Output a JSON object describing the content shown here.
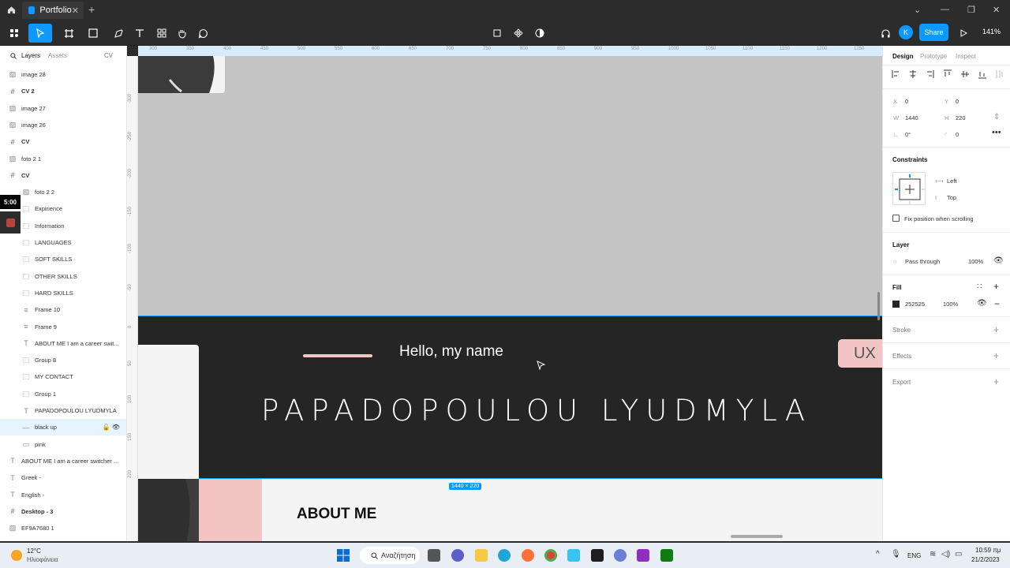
{
  "titlebar": {
    "tab_title": "Portfolio",
    "close": "✕",
    "new_tab": "+"
  },
  "toolbar": {
    "share_label": "Share",
    "zoom": "141%",
    "user_initial": "K"
  },
  "leftpanel": {
    "tabs": {
      "layers": "Layers",
      "assets": "Assets",
      "page": "CV"
    },
    "layers": [
      {
        "label": "image 28",
        "kind": "image",
        "indent": 0
      },
      {
        "label": "CV 2",
        "kind": "frame",
        "indent": 0
      },
      {
        "label": "image 27",
        "kind": "image",
        "indent": 0
      },
      {
        "label": "image 26",
        "kind": "image",
        "indent": 0
      },
      {
        "label": "CV",
        "kind": "frame",
        "indent": 0
      },
      {
        "label": "foto 2 1",
        "kind": "image",
        "indent": 0
      },
      {
        "label": "CV",
        "kind": "frame",
        "indent": 0
      },
      {
        "label": "foto 2 2",
        "kind": "image",
        "indent": 1
      },
      {
        "label": "Expirience",
        "kind": "group",
        "indent": 1
      },
      {
        "label": "Information",
        "kind": "group",
        "indent": 1
      },
      {
        "label": "LANGUAGES",
        "kind": "group",
        "indent": 1
      },
      {
        "label": "SOFT SKILLS",
        "kind": "group",
        "indent": 1
      },
      {
        "label": "OTHER SKILLS",
        "kind": "group",
        "indent": 1
      },
      {
        "label": "HARD SKILLS",
        "kind": "group",
        "indent": 1
      },
      {
        "label": "Frame 10",
        "kind": "autolayout",
        "indent": 1
      },
      {
        "label": "Frame 9",
        "kind": "autolayout",
        "indent": 1
      },
      {
        "label": "ABOUT ME I am a career swit...",
        "kind": "text",
        "indent": 1
      },
      {
        "label": "Group 8",
        "kind": "group",
        "indent": 1
      },
      {
        "label": "MY CONTACT",
        "kind": "group",
        "indent": 1
      },
      {
        "label": "Group 1",
        "kind": "group",
        "indent": 1
      },
      {
        "label": "PAPADOPOULOU LYUDMYLA",
        "kind": "text",
        "indent": 1
      },
      {
        "label": "black up",
        "kind": "rect",
        "indent": 1,
        "selected": true
      },
      {
        "label": "pink",
        "kind": "rect",
        "indent": 1
      },
      {
        "label": "ABOUT ME I am a career switcher ...",
        "kind": "text",
        "indent": 0
      },
      {
        "label": "Greek -",
        "kind": "text",
        "indent": 0
      },
      {
        "label": "English -",
        "kind": "text",
        "indent": 0
      },
      {
        "label": "Desktop - 3",
        "kind": "frame",
        "indent": 0
      },
      {
        "label": "EF9A7680 1",
        "kind": "image",
        "indent": 0
      }
    ],
    "timer": "5:00"
  },
  "ruler": {
    "top": [
      "300",
      "350",
      "400",
      "450",
      "500",
      "550",
      "600",
      "650",
      "700",
      "750",
      "800",
      "850",
      "900",
      "950",
      "1000",
      "1050",
      "1100",
      "1150",
      "1200",
      "1250"
    ],
    "left": [
      "-300",
      "-250",
      "-200",
      "-150",
      "-100",
      "-50",
      "0",
      "50",
      "100",
      "150",
      "220"
    ]
  },
  "canvas": {
    "hello": "Hello, my name",
    "name": "PAPADOPOULOU LYUDMYLA",
    "ux": "UX",
    "about": "ABOUT ME",
    "dimensions": "1440 × 220",
    "help": "?"
  },
  "rightpanel": {
    "tabs": {
      "design": "Design",
      "prototype": "Prototype",
      "inspect": "Inspect"
    },
    "x_label": "X",
    "x": "0",
    "y_label": "Y",
    "y": "0",
    "w_label": "W",
    "w": "1440",
    "h_label": "H",
    "h": "220",
    "rotation": "0°",
    "radius": "0",
    "constraints": "Constraints",
    "constraint_h": "Left",
    "constraint_v": "Top",
    "fix_position": "Fix position when scrolling",
    "layer": "Layer",
    "blend": "Pass through",
    "opacity": "100%",
    "fill": "Fill",
    "fill_hex": "252525",
    "fill_opacity": "100%",
    "fill_color": "#252525",
    "stroke": "Stroke",
    "effects": "Effects",
    "export": "Export"
  },
  "taskbar": {
    "weather_temp": "12°C",
    "weather_desc": "Ηλιοφάνεια",
    "search": "Αναζήτηση",
    "lang": "ENG",
    "time": "10:59 πμ",
    "date": "21/2/2023"
  }
}
